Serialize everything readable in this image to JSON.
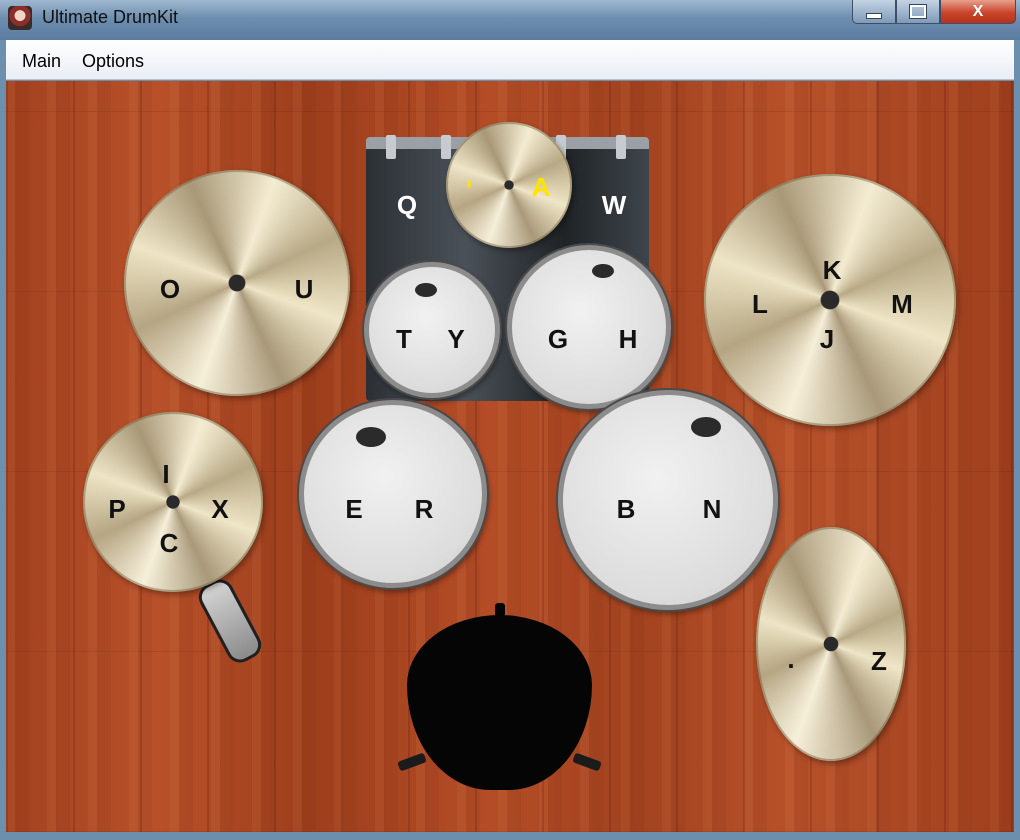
{
  "window": {
    "title": "Ultimate DrumKit",
    "controls": {
      "minimize": "",
      "maximize": "",
      "close": "X"
    }
  },
  "menu": {
    "items": [
      "Main",
      "Options"
    ]
  },
  "colors": {
    "floor": "#b04a25",
    "menubar": "#ffffff",
    "key_dark": "#111111",
    "key_light": "#ffffff",
    "key_highlight": "#ffe400"
  },
  "kit": {
    "crash_left": {
      "keys": [
        "O",
        "U"
      ]
    },
    "splash_top": {
      "keys": [
        "'",
        "A"
      ]
    },
    "bass_drum": {
      "keys": [
        "Q",
        "W"
      ]
    },
    "tom_small": {
      "keys": [
        "T",
        "Y"
      ]
    },
    "tom_medium": {
      "keys": [
        "G",
        "H"
      ]
    },
    "ride_right": {
      "keys": [
        "K",
        "L",
        "M",
        "J"
      ]
    },
    "hihat": {
      "keys": [
        "I",
        "P",
        "X",
        "C"
      ]
    },
    "snare": {
      "keys": [
        "E",
        "R"
      ]
    },
    "floor_tom": {
      "keys": [
        "B",
        "N"
      ]
    },
    "china": {
      "keys": [
        ".",
        "Z"
      ]
    }
  }
}
